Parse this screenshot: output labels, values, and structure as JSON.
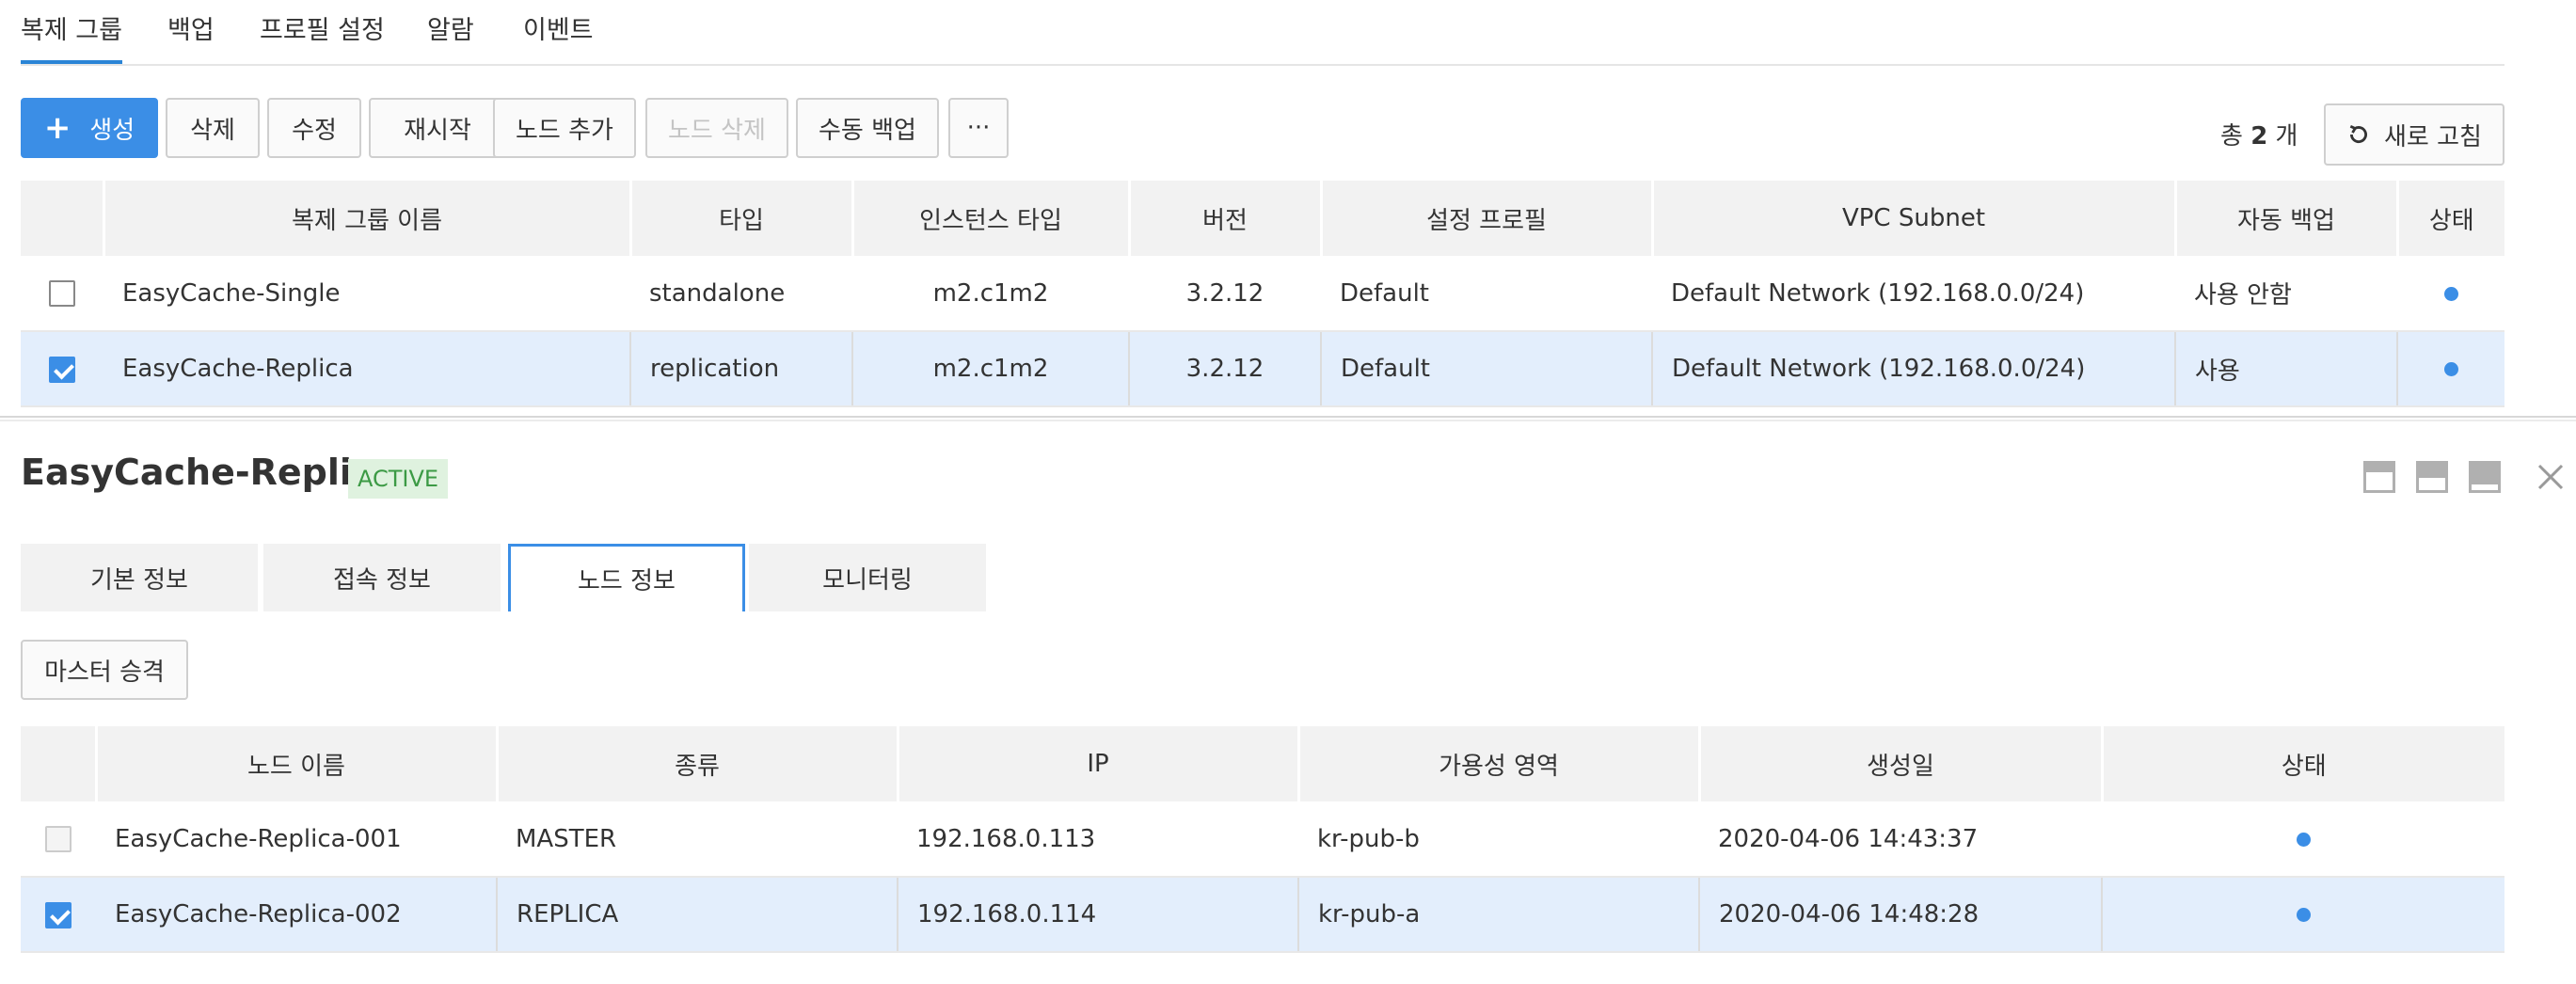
{
  "top_tabs": [
    {
      "label": "복제 그룹",
      "active": true
    },
    {
      "label": "백업",
      "active": false
    },
    {
      "label": "프로필 설정",
      "active": false
    },
    {
      "label": "알람",
      "active": false
    },
    {
      "label": "이벤트",
      "active": false
    }
  ],
  "toolbar": {
    "create_label": "생성",
    "delete_label": "삭제",
    "modify_label": "수정",
    "restart_label": "재시작",
    "add_node_label": "노드 추가",
    "delete_node_label": "노드 삭제",
    "manual_backup_label": "수동 백업",
    "more_label": "···",
    "total_prefix": "총",
    "total_count": "2",
    "total_suffix": "개",
    "refresh_label": "새로 고침"
  },
  "groups_table": {
    "headers": [
      "복제 그룹 이름",
      "타입",
      "인스턴스 타입",
      "버전",
      "설정 프로필",
      "VPC Subnet",
      "자동 백업",
      "상태"
    ],
    "rows": [
      {
        "name": "EasyCache-Single",
        "type": "standalone",
        "instance_type": "m2.c1m2",
        "version": "3.2.12",
        "profile": "Default",
        "subnet": "Default Network (192.168.0.0/24)",
        "auto_backup": "사용 안함",
        "status": "active",
        "selected": false
      },
      {
        "name": "EasyCache-Replica",
        "type": "replication",
        "instance_type": "m2.c1m2",
        "version": "3.2.12",
        "profile": "Default",
        "subnet": "Default Network (192.168.0.0/24)",
        "auto_backup": "사용",
        "status": "active",
        "selected": true
      }
    ]
  },
  "detail": {
    "title": "EasyCache-Replica",
    "badge": "ACTIVE",
    "tabs": [
      {
        "label": "기본 정보",
        "active": false
      },
      {
        "label": "접속 정보",
        "active": false
      },
      {
        "label": "노드 정보",
        "active": true
      },
      {
        "label": "모니터링",
        "active": false
      }
    ],
    "master_promote_label": "마스터 승격"
  },
  "nodes_table": {
    "headers": [
      "노드 이름",
      "종류",
      "IP",
      "가용성 영역",
      "생성일",
      "상태"
    ],
    "rows": [
      {
        "name": "EasyCache-Replica-001",
        "kind": "MASTER",
        "ip": "192.168.0.113",
        "zone": "kr-pub-b",
        "created": "2020-04-06 14:43:37",
        "status": "active",
        "selected": false
      },
      {
        "name": "EasyCache-Replica-002",
        "kind": "REPLICA",
        "ip": "192.168.0.114",
        "zone": "kr-pub-a",
        "created": "2020-04-06 14:48:28",
        "status": "active",
        "selected": true
      }
    ]
  },
  "colors": {
    "accent": "#3b8ee6",
    "selected_row": "#e3eefc",
    "active_badge_bg": "#dff2df",
    "active_badge_text": "#3c9a45"
  },
  "icons": [
    "plus-icon",
    "refresh-icon",
    "panel-top-icon",
    "panel-middle-icon",
    "panel-bottom-icon",
    "close-icon",
    "status-dot-icon"
  ]
}
